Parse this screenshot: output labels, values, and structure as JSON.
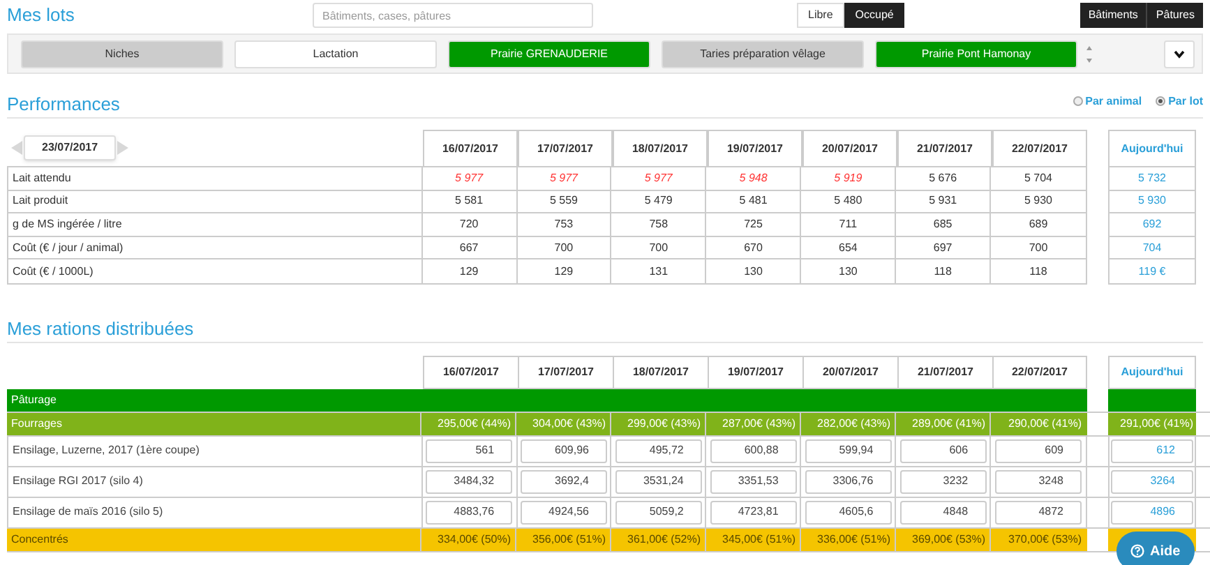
{
  "lots_title": "Mes lots",
  "search": {
    "placeholder": "Bâtiments, cases, pâtures"
  },
  "occupancy": [
    {
      "label": "Libre",
      "selected": false
    },
    {
      "label": "Occupé",
      "selected": true
    }
  ],
  "location_buttons": [
    "Bâtiments",
    "Pâtures"
  ],
  "lots": [
    {
      "label": "Niches",
      "color": "#cccccc"
    },
    {
      "label": "Lactation",
      "color": "#ffffff"
    },
    {
      "label": "Prairie GRENAUDERIE",
      "color": "#009900"
    },
    {
      "label": "Taries préparation vêlage",
      "color": "#cccccc"
    },
    {
      "label": "Prairie Pont Hamonay",
      "color": "#009900"
    }
  ],
  "performances": {
    "title": "Performances",
    "view_options": [
      {
        "label": "Par animal",
        "selected": false
      },
      {
        "label": "Par lot",
        "selected": true
      }
    ],
    "date": "23/07/2017",
    "columns": [
      "16/07/2017",
      "17/07/2017",
      "18/07/2017",
      "19/07/2017",
      "20/07/2017",
      "21/07/2017",
      "22/07/2017"
    ],
    "today_label": "Aujourd'hui",
    "rows": [
      {
        "label": "Lait attendu",
        "values": [
          {
            "text": "5 977",
            "alert": true
          },
          {
            "text": "5 977",
            "alert": true
          },
          {
            "text": "5 977",
            "alert": true
          },
          {
            "text": "5 948",
            "alert": true
          },
          {
            "text": "5 919",
            "alert": true
          },
          {
            "text": "5 676",
            "alert": false
          },
          {
            "text": "5 704",
            "alert": false
          }
        ],
        "today": "5 732"
      },
      {
        "label": "Lait produit",
        "values": [
          {
            "text": "5 581",
            "alert": false
          },
          {
            "text": "5 559",
            "alert": false
          },
          {
            "text": "5 479",
            "alert": false
          },
          {
            "text": "5 481",
            "alert": false
          },
          {
            "text": "5 480",
            "alert": false
          },
          {
            "text": "5 931",
            "alert": false
          },
          {
            "text": "5 930",
            "alert": false
          }
        ],
        "today": "5 930"
      },
      {
        "label": "g de MS ingérée / litre",
        "values": [
          {
            "text": "720",
            "alert": false
          },
          {
            "text": "753",
            "alert": false
          },
          {
            "text": "758",
            "alert": false
          },
          {
            "text": "725",
            "alert": false
          },
          {
            "text": "711",
            "alert": false
          },
          {
            "text": "685",
            "alert": false
          },
          {
            "text": "689",
            "alert": false
          }
        ],
        "today": "692"
      },
      {
        "label": "Coût (€ / jour / animal)",
        "values": [
          {
            "text": "667",
            "alert": false
          },
          {
            "text": "700",
            "alert": false
          },
          {
            "text": "700",
            "alert": false
          },
          {
            "text": "670",
            "alert": false
          },
          {
            "text": "654",
            "alert": false
          },
          {
            "text": "697",
            "alert": false
          },
          {
            "text": "700",
            "alert": false
          }
        ],
        "today": "704"
      },
      {
        "label": "Coût (€ / 1000L)",
        "values": [
          {
            "text": "129",
            "alert": false
          },
          {
            "text": "129",
            "alert": false
          },
          {
            "text": "131",
            "alert": false
          },
          {
            "text": "130",
            "alert": false
          },
          {
            "text": "130",
            "alert": false
          },
          {
            "text": "118",
            "alert": false
          },
          {
            "text": "118",
            "alert": false
          }
        ],
        "today": "119 €"
      }
    ]
  },
  "rations": {
    "title": "Mes rations distribuées",
    "columns": [
      "16/07/2017",
      "17/07/2017",
      "18/07/2017",
      "19/07/2017",
      "20/07/2017",
      "21/07/2017",
      "22/07/2017"
    ],
    "today_label": "Aujourd'hui",
    "rows": [
      {
        "kind": "group",
        "label": "Pâturage",
        "color": "#009900"
      },
      {
        "kind": "category",
        "label": "Fourrages",
        "color": "#80b31a",
        "values": [
          "295,00€ (44%)",
          "304,00€ (43%)",
          "299,00€ (43%)",
          "287,00€ (43%)",
          "282,00€ (43%)",
          "289,00€ (41%)",
          "290,00€ (41%)"
        ],
        "today": "291,00€ (41%)"
      },
      {
        "kind": "item",
        "label": "Ensilage, Luzerne, 2017 (1ère coupe)",
        "values": [
          "561",
          "609,96",
          "495,72",
          "600,88",
          "599,94",
          "606",
          "609"
        ],
        "today": "612"
      },
      {
        "kind": "item",
        "label": "Ensilage RGI 2017 (silo 4)",
        "values": [
          "3484,32",
          "3692,4",
          "3531,24",
          "3351,53",
          "3306,76",
          "3232",
          "3248"
        ],
        "today": "3264"
      },
      {
        "kind": "item",
        "label": "Ensilage de maïs 2016 (silo 5)",
        "values": [
          "4883,76",
          "4924,56",
          "5059,2",
          "4723,81",
          "4605,6",
          "4848",
          "4872"
        ],
        "today": "4896"
      },
      {
        "kind": "category",
        "label": "Concentrés",
        "color": "#f5c400",
        "values": [
          "334,00€ (50%)",
          "356,00€ (51%)",
          "361,00€ (52%)",
          "345,00€ (51%)",
          "336,00€ (51%)",
          "369,00€ (53%)",
          "370,00€ (53%)"
        ]
      }
    ]
  },
  "help_button": "Aide"
}
